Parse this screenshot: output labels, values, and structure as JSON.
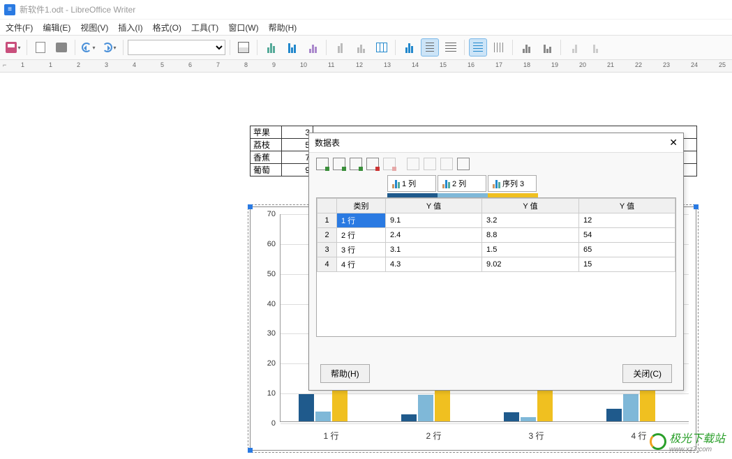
{
  "titlebar": {
    "title": "新软件1.odt - LibreOffice Writer"
  },
  "menubar": {
    "file": "文件(F)",
    "edit": "编辑(E)",
    "view": "视图(V)",
    "insert": "插入(I)",
    "format": "格式(O)",
    "tools": "工具(T)",
    "window": "窗口(W)",
    "help": "帮助(H)"
  },
  "ruler_marks": [
    "1",
    "1",
    "2",
    "3",
    "4",
    "5",
    "6",
    "7",
    "8",
    "9",
    "10",
    "11",
    "12",
    "13",
    "14",
    "15",
    "16",
    "17",
    "18",
    "19",
    "20",
    "21",
    "22",
    "23",
    "24",
    "25"
  ],
  "mini_table": {
    "rows": [
      {
        "name": "苹果",
        "val": "3"
      },
      {
        "name": "荔枝",
        "val": "5"
      },
      {
        "name": "香蕉",
        "val": "7"
      },
      {
        "name": "葡萄",
        "val": "9"
      }
    ]
  },
  "dialog": {
    "title": "数据表",
    "help": "帮助(H)",
    "close": "关闭(C)",
    "series": [
      "1 列",
      "2 列",
      "序列 3"
    ],
    "series_colors": [
      "#1f5a8c",
      "#7fb8d8",
      "#f0c020"
    ],
    "columns": [
      "",
      "类别",
      "Y 值",
      "Y 值",
      "Y 值"
    ],
    "rows": [
      {
        "n": "1",
        "cat": "1 行",
        "a": "9.1",
        "b": "3.2",
        "c": "12"
      },
      {
        "n": "2",
        "cat": "2 行",
        "a": "2.4",
        "b": "8.8",
        "c": "54"
      },
      {
        "n": "3",
        "cat": "3 行",
        "a": "3.1",
        "b": "1.5",
        "c": "65"
      },
      {
        "n": "4",
        "cat": "4 行",
        "a": "4.3",
        "b": "9.02",
        "c": "15"
      }
    ]
  },
  "chart_data": {
    "type": "bar",
    "categories": [
      "1 行",
      "2 行",
      "3 行",
      "4 行"
    ],
    "series": [
      {
        "name": "1 列",
        "color": "#1f5a8c",
        "values": [
          9.1,
          2.4,
          3.1,
          4.3
        ]
      },
      {
        "name": "2 列",
        "color": "#7fb8d8",
        "values": [
          3.2,
          8.8,
          1.5,
          9.02
        ]
      },
      {
        "name": "序列 3",
        "color": "#f0c020",
        "values": [
          12,
          54,
          65,
          15
        ]
      }
    ],
    "yticks": [
      0,
      10,
      20,
      30,
      40,
      50,
      60,
      70
    ],
    "ylim": [
      0,
      70
    ],
    "title": "",
    "xlabel": "",
    "ylabel": ""
  },
  "watermark": {
    "text": "极光下载站",
    "url": "www.xz7.com"
  }
}
